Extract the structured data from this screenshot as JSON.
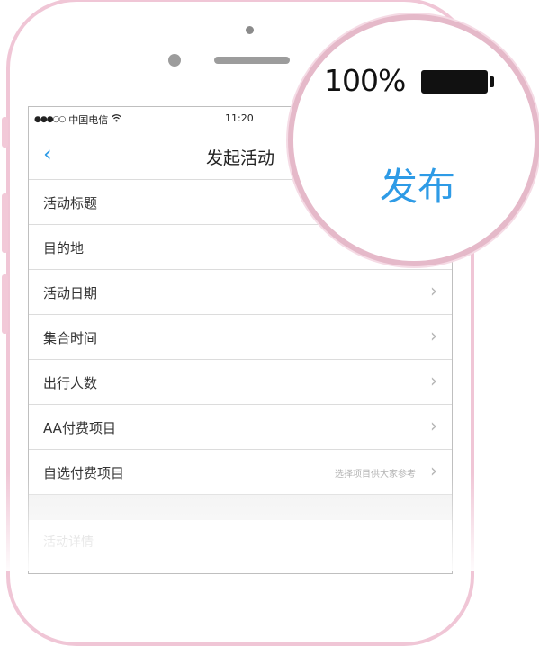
{
  "status_bar": {
    "signal": "●●●○○",
    "carrier": "中国电信",
    "wifi_icon": "wifi-icon",
    "time": "11:20"
  },
  "nav": {
    "back_icon": "chevron-left-icon",
    "back_glyph": "‹",
    "title": "发起活动"
  },
  "form": {
    "rows": [
      {
        "label": "活动标题",
        "hint": "",
        "chevron": false
      },
      {
        "label": "目的地",
        "hint": "",
        "chevron": false
      },
      {
        "label": "活动日期",
        "hint": "",
        "chevron": true
      },
      {
        "label": "集合时间",
        "hint": "",
        "chevron": true
      },
      {
        "label": "出行人数",
        "hint": "",
        "chevron": true
      },
      {
        "label": "AA付费项目",
        "hint": "",
        "chevron": true
      },
      {
        "label": "自选付费项目",
        "hint": "选择项目供大家参考",
        "chevron": true
      }
    ],
    "detail_label": "活动详情",
    "chevron_glyph": "›"
  },
  "magnifier": {
    "battery_percent": "100%",
    "battery_icon": "battery-full-icon",
    "publish_label": "发布"
  },
  "colors": {
    "accent": "#2e9be6",
    "phone_frame": "#f0c6d6",
    "magnifier_ring": "#e5b9c9"
  }
}
